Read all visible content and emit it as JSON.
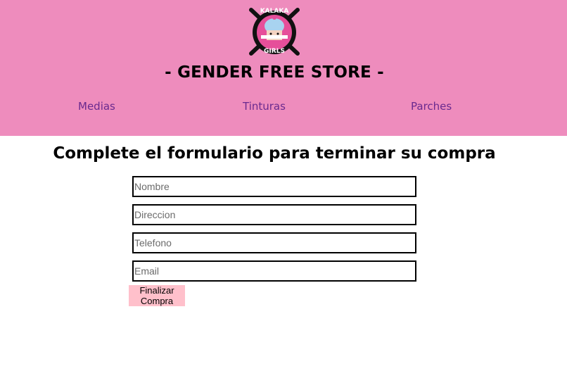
{
  "header": {
    "logo_text_top": "KALAKA",
    "logo_text_bottom": "GIRLS",
    "store_title": "- GENDER FREE STORE -",
    "nav": [
      {
        "label": "Medias"
      },
      {
        "label": "Tinturas"
      },
      {
        "label": "Parches"
      }
    ]
  },
  "form": {
    "title": "Complete el formulario para terminar su compra",
    "fields": [
      {
        "placeholder": "Nombre",
        "value": ""
      },
      {
        "placeholder": "Direccion",
        "value": ""
      },
      {
        "placeholder": "Telefono",
        "value": ""
      },
      {
        "placeholder": "Email",
        "value": ""
      }
    ],
    "submit_line1": "Finalizar",
    "submit_line2": "Compra"
  },
  "colors": {
    "header_bg": "#ee8cbd",
    "nav_link": "#6a2a8f",
    "button_bg": "#ffc0cb"
  }
}
